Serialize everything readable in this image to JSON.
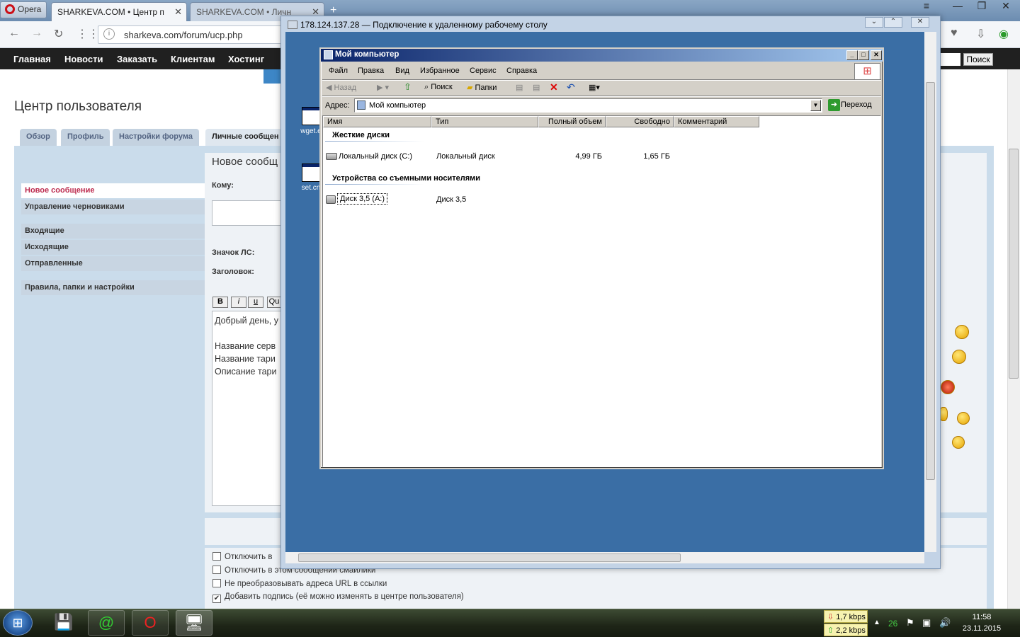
{
  "browser": {
    "opera_label": "Opera",
    "tabs": [
      {
        "label": "SHARKEVA.COM • Центр п"
      },
      {
        "label": "SHARKEVA.COM • Личн"
      }
    ],
    "new_tab": "+",
    "url": "sharkeva.com/forum/ucp.php"
  },
  "site_menu": {
    "items": [
      "Главная",
      "Новости",
      "Заказать",
      "Клиентам",
      "Хостинг"
    ],
    "search_button": "Поиск"
  },
  "forum": {
    "page_title": "Центр пользователя",
    "tabs": [
      "Обзор",
      "Профиль",
      "Настройки форума",
      "Личные сообщен"
    ],
    "section_title": "Новое сообщ",
    "sidebar": [
      "Новое сообщение",
      "Управление черновиками",
      "Входящие",
      "Исходящие",
      "Отправленные",
      "Правила, папки и настройки"
    ],
    "labels": {
      "to": "Кому:",
      "icon": "Значок ЛС:",
      "subject": "Заголовок:"
    },
    "bbcode": [
      "B",
      "i",
      "u",
      "Qu"
    ],
    "message_lines": [
      "Добрый день, у",
      "",
      "Название серв",
      "Название тари",
      "Описание тари"
    ],
    "options": [
      {
        "label": "Отключить в",
        "checked": false
      },
      {
        "label": "Отключить в этом сообщении смайлики",
        "checked": false
      },
      {
        "label": "Не преобразовывать адреса URL в ссылки",
        "checked": false
      },
      {
        "label": "Добавить подпись (её можно изменять в центре пользователя)",
        "checked": true
      }
    ]
  },
  "rdp": {
    "title": "178.124.137.28 — Подключение к удаленному рабочему столу",
    "desktop_icons": [
      "wget.e",
      "set.cn"
    ]
  },
  "explorer": {
    "title": "Мой компьютер",
    "menu": [
      "Файл",
      "Правка",
      "Вид",
      "Избранное",
      "Сервис",
      "Справка"
    ],
    "toolbar": {
      "back": "Назад",
      "search": "Поиск",
      "folders": "Папки"
    },
    "address_label": "Адрес:",
    "address_value": "Мой компьютер",
    "go_label": "Переход",
    "columns": [
      "Имя",
      "Тип",
      "Полный объем",
      "Свободно",
      "Комментарий"
    ],
    "groups": [
      {
        "title": "Жесткие диски",
        "items": [
          {
            "name": "Локальный диск (C:)",
            "type": "Локальный диск",
            "total": "4,99 ГБ",
            "free": "1,65 ГБ"
          }
        ]
      },
      {
        "title": "Устройства со съемными носителями",
        "items": [
          {
            "name": "Диск 3,5 (A:)",
            "type": "Диск 3,5",
            "total": "",
            "free": ""
          }
        ]
      }
    ]
  },
  "taskbar": {
    "download_speed": "1,7 kbps",
    "upload_speed": "2,2 kbps",
    "tray_count": "26",
    "time": "11:58",
    "date": "23.11.2015"
  },
  "colors": {
    "menu_bar": "#202020",
    "forum_panel": "#cadceb",
    "remote_desktop": "#3a6ea5",
    "active_sidebar": "#bc2a4d"
  }
}
